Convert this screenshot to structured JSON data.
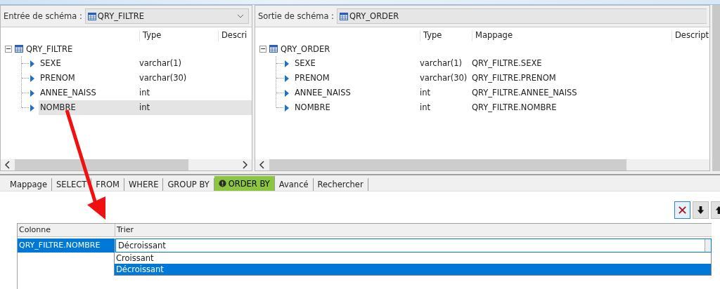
{
  "input_schema": {
    "label": "Entrée de schéma :",
    "schema": "QRY_FILTRE",
    "columns": [
      "Type",
      "Descri"
    ],
    "root": "QRY_FILTRE",
    "expanded": true,
    "rows": [
      {
        "name": "SEXE",
        "type": "varchar(1)",
        "selected": false
      },
      {
        "name": "PRENOM",
        "type": "varchar(30)",
        "selected": false
      },
      {
        "name": "ANNEE_NAISS",
        "type": "int",
        "selected": false
      },
      {
        "name": "NOMBRE",
        "type": "int",
        "selected": true
      }
    ]
  },
  "output_schema": {
    "label": "Sortie de schéma :",
    "schema": "QRY_ORDER",
    "columns": [
      "Type",
      "Mappage",
      "Descript"
    ],
    "root": "QRY_ORDER",
    "expanded": true,
    "rows": [
      {
        "name": "SEXE",
        "type": "varchar(1)",
        "mapping": "QRY_FILTRE.SEXE"
      },
      {
        "name": "PRENOM",
        "type": "varchar(30)",
        "mapping": "QRY_FILTRE.PRENOM"
      },
      {
        "name": "ANNEE_NAISS",
        "type": "int",
        "mapping": "QRY_FILTRE.ANNEE_NAISS"
      },
      {
        "name": "NOMBRE",
        "type": "int",
        "mapping": "QRY_FILTRE.NOMBRE"
      }
    ]
  },
  "tabs": [
    {
      "label": "Mappage",
      "selected": false,
      "alert": false
    },
    {
      "label": "SELECT",
      "selected": false,
      "alert": false
    },
    {
      "label": "FROM",
      "selected": false,
      "alert": false
    },
    {
      "label": "WHERE",
      "selected": false,
      "alert": false
    },
    {
      "label": "GROUP BY",
      "selected": false,
      "alert": false
    },
    {
      "label": "ORDER BY",
      "selected": true,
      "alert": true
    },
    {
      "label": "Avancé",
      "selected": false,
      "alert": false
    },
    {
      "label": "Rechercher",
      "selected": false,
      "alert": false
    }
  ],
  "toolbar": [
    {
      "kind": "delete",
      "focused": true
    },
    {
      "kind": "down",
      "focused": false
    },
    {
      "kind": "up",
      "focused": false
    }
  ],
  "sort_table": {
    "columns": [
      "Colonne",
      "Trier"
    ],
    "rows": [
      {
        "column": "QRY_FILTRE.NOMBRE",
        "selected": true,
        "order": "Décroissant",
        "open": true,
        "options": [
          {
            "label": "Croissant",
            "selected": false
          },
          {
            "label": "Décroissant",
            "selected": true
          }
        ]
      }
    ]
  }
}
